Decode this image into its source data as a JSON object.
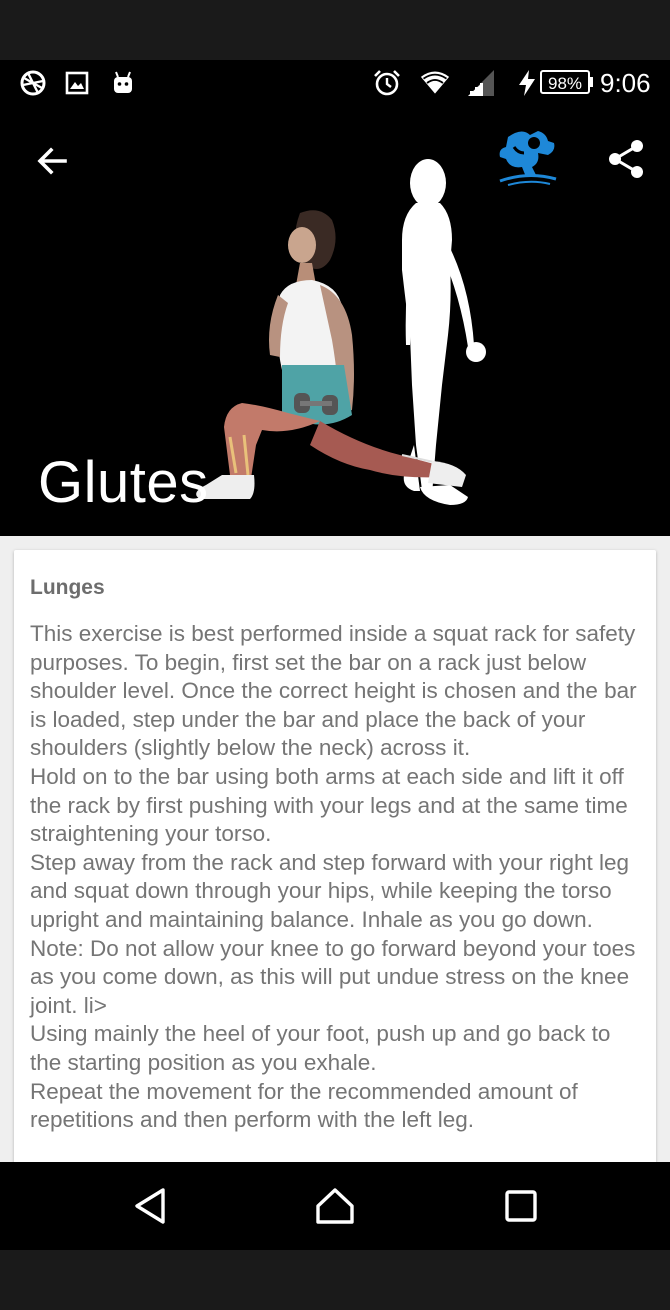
{
  "status_bar": {
    "left_icons": [
      "vpn-key-icon",
      "image-notification-icon",
      "android-notification-icon"
    ],
    "right_icons": [
      "alarm-icon",
      "wifi-icon",
      "cell-signal-icon",
      "charging-bolt-icon"
    ],
    "battery": "98%",
    "time": "9:06"
  },
  "toolbar": {
    "back_icon": "arrow-back-icon",
    "logo_icon": "fitness-logo-icon",
    "share_icon": "share-icon"
  },
  "hero": {
    "title": "Glutes",
    "image": "lunge-exercise-illustration"
  },
  "exercise": {
    "name": "Lunges",
    "paragraphs": [
      "This exercise is best performed inside a squat rack for safety purposes. To begin, first set the bar on a rack just below shoulder level. Once the correct height is chosen and the bar is loaded, step under the bar and place the back of your shoulders (slightly below the neck) across it.",
      "Hold on to the bar using both arms at each side and lift it off the rack by first pushing with your legs and at the same time straightening your torso.",
      "Step away from the rack and step forward with your right leg and squat down through your hips, while keeping the torso upright and maintaining balance. Inhale as you go down. Note: Do not allow your knee to go forward beyond your toes as you come down, as this will put undue stress on the knee joint. li>",
      "Using mainly the heel of your foot, push up and go back to the starting position as you exhale.",
      "Repeat the movement for the recommended amount of repetitions and then perform with the left leg."
    ]
  },
  "nav_bar": {
    "back": "nav-back-icon",
    "home": "nav-home-icon",
    "recents": "nav-recents-icon"
  },
  "colors": {
    "accent": "#1e88d8",
    "body_text": "#757575",
    "title_text": "#6d6d6d",
    "background": "#000000"
  }
}
